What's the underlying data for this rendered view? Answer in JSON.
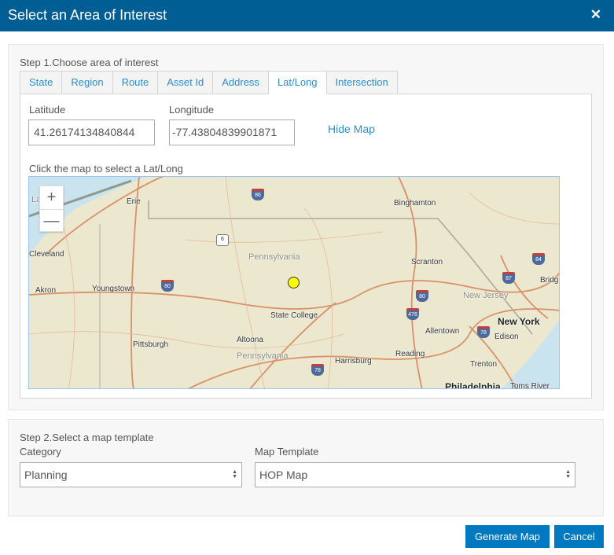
{
  "dialog": {
    "title": "Select an Area of Interest",
    "close_icon": "close-icon"
  },
  "step1": {
    "label": "Step 1.Choose area of interest",
    "tabs": [
      {
        "label": "State"
      },
      {
        "label": "Region"
      },
      {
        "label": "Route"
      },
      {
        "label": "Asset Id"
      },
      {
        "label": "Address"
      },
      {
        "label": "Lat/Long",
        "active": true
      },
      {
        "label": "Intersection"
      }
    ],
    "latitude_label": "Latitude",
    "latitude_value": "41.26174134840844",
    "longitude_label": "Longitude",
    "longitude_value": "-77.43804839901871",
    "hide_map": "Hide Map",
    "map_hint": "Click the map to select a Lat/Long",
    "map": {
      "zoom_in": "+",
      "zoom_out": "—",
      "marker_color": "#ffff00",
      "labels": [
        "Erie",
        "Binghamton",
        "Cleveland",
        "Pennsylvania",
        "Scranton",
        "Akron",
        "Youngstown",
        "State College",
        "New Jersey",
        "New York",
        "Allentown",
        "Edison",
        "Pittsburgh",
        "Altoona",
        "Pennsylvania",
        "Reading",
        "Harrisburg",
        "Trenton",
        "Philadelphia",
        "Toms River",
        "Bridg",
        "Lak"
      ],
      "shields": [
        "86",
        "6",
        "80",
        "80",
        "476",
        "84",
        "87",
        "78",
        "78"
      ]
    }
  },
  "step2": {
    "label": "Step 2.Select a map template",
    "category_label": "Category",
    "category_value": "Planning",
    "template_label": "Map Template",
    "template_value": "HOP Map"
  },
  "buttons": {
    "generate": "Generate Map",
    "cancel": "Cancel"
  },
  "colors": {
    "header": "#005e95",
    "button": "#0079c1",
    "link": "#2b8ed3"
  }
}
